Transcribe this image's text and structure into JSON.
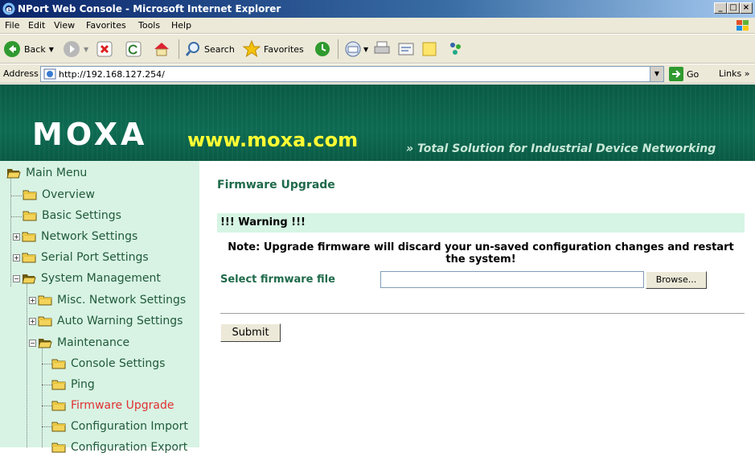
{
  "window": {
    "title": "NPort Web Console - Microsoft Internet Explorer"
  },
  "menubar": {
    "items": [
      "File",
      "Edit",
      "View",
      "Favorites",
      "Tools",
      "Help"
    ]
  },
  "toolbar": {
    "back_label": "Back",
    "search_label": "Search",
    "favorites_label": "Favorites"
  },
  "addressbar": {
    "label": "Address",
    "url": "http://192.168.127.254/",
    "go_label": "Go",
    "links_label": "Links"
  },
  "header": {
    "logo": "MOXA",
    "site": "www.moxa.com",
    "slogan": "Total Solution for Industrial Device Networking"
  },
  "sidebar": {
    "items": [
      {
        "label": "Main Menu",
        "icon": "folder-open-icon"
      },
      {
        "label": "Overview",
        "icon": "folder-icon"
      },
      {
        "label": "Basic Settings",
        "icon": "folder-icon"
      },
      {
        "label": "Network Settings",
        "icon": "folder-icon",
        "expander": "plus"
      },
      {
        "label": "Serial Port Settings",
        "icon": "folder-icon",
        "expander": "plus"
      },
      {
        "label": "System Management",
        "icon": "folder-open-icon",
        "expander": "minus"
      },
      {
        "label": "Misc. Network Settings",
        "icon": "folder-icon",
        "expander": "plus"
      },
      {
        "label": "Auto Warning Settings",
        "icon": "folder-icon",
        "expander": "plus"
      },
      {
        "label": "Maintenance",
        "icon": "folder-open-icon",
        "expander": "minus"
      },
      {
        "label": "Console Settings",
        "icon": "folder-icon"
      },
      {
        "label": "Ping",
        "icon": "folder-icon"
      },
      {
        "label": "Firmware Upgrade",
        "icon": "folder-icon",
        "active": true
      },
      {
        "label": "Configuration Import",
        "icon": "folder-icon"
      },
      {
        "label": "Configuration Export",
        "icon": "folder-icon"
      }
    ]
  },
  "main": {
    "title": "Firmware Upgrade",
    "warning": "!!! Warning !!!",
    "note": "Note: Upgrade firmware will discard your un-saved configuration changes and restart the system!",
    "file_label": "Select firmware file",
    "file_value": "",
    "browse_label": "Browse...",
    "submit_label": "Submit"
  },
  "colors": {
    "active_item": "#e03030",
    "header_green": "#0d6b52",
    "sidebar_bg": "#d8f3e4",
    "heading_green": "#1f6a4a"
  }
}
